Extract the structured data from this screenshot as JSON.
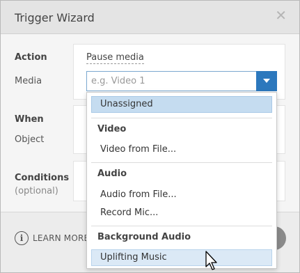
{
  "window": {
    "title": "Trigger Wizard",
    "close_glyph": "✕"
  },
  "action": {
    "label": "Action",
    "value": "Pause media"
  },
  "media": {
    "label": "Media",
    "placeholder": "e.g. Video 1",
    "value": ""
  },
  "when": {
    "label": "When",
    "object_label": "Object"
  },
  "conditions": {
    "label": "Conditions",
    "sub": "(optional)"
  },
  "footer": {
    "learn_more": "LEARN MORE"
  },
  "dropdown": {
    "unassigned": "Unassigned",
    "groups": {
      "video": "Video",
      "audio": "Audio",
      "background_audio": "Background Audio"
    },
    "items": {
      "video_from_file": "Video from File...",
      "audio_from_file": "Audio from File...",
      "record_mic": "Record Mic...",
      "uplifting_music": "Uplifting Music"
    }
  },
  "colors": {
    "accent": "#2c78bd",
    "selected": "#c5dcf0",
    "hover": "#dbe9f6"
  },
  "icons": {
    "close": "close-icon",
    "dropdown": "chevron-down-icon",
    "info": "info-icon",
    "cursor": "mouse-pointer-icon"
  }
}
